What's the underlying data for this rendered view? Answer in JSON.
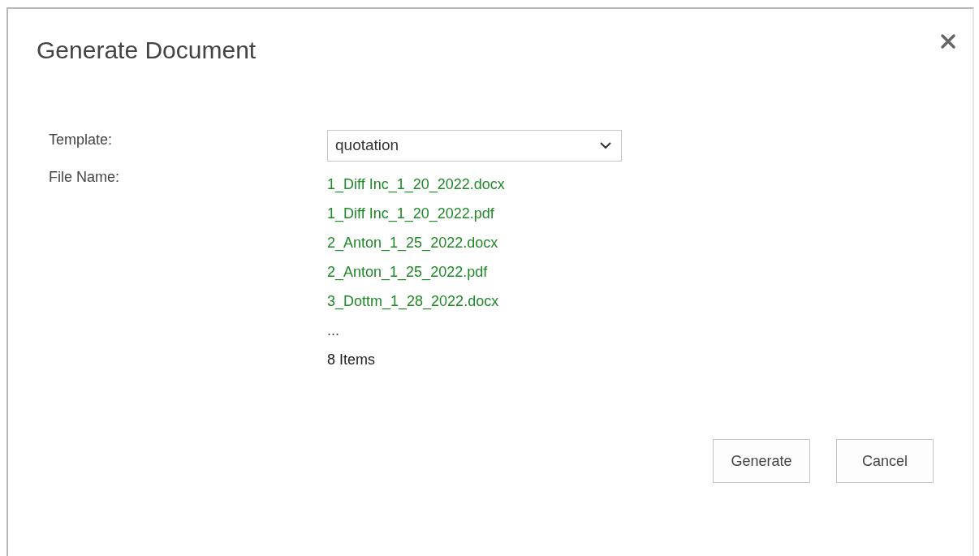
{
  "dialog": {
    "title": "Generate Document"
  },
  "form": {
    "template_label": "Template:",
    "template_value": "quotation",
    "file_name_label": "File Name:",
    "files": [
      "1_Diff Inc_1_20_2022.docx",
      "1_Diff Inc_1_20_2022.pdf",
      "2_Anton_1_25_2022.docx",
      "2_Anton_1_25_2022.pdf",
      "3_Dottm_1_28_2022.docx"
    ],
    "more": "...",
    "count": "8 Items"
  },
  "buttons": [
    "Generate",
    "Cancel"
  ]
}
